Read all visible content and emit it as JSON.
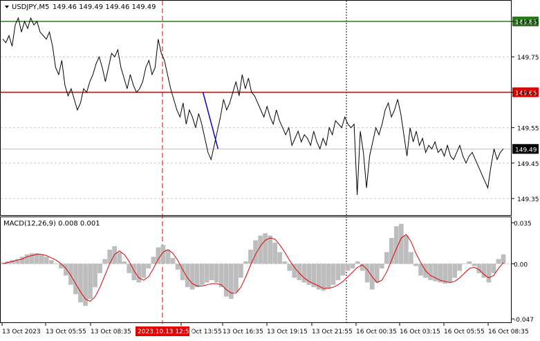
{
  "header": {
    "symbol_title": "USDJPY,M5",
    "ohlc": "149.46 149.49 149.46 149.49"
  },
  "macd_label": "MACD(12,26,9) 0.008 0.001",
  "colors": {
    "price_line": "#000000",
    "support_line": "#e00000",
    "resistance_line": "#2a7a1a",
    "trend_line": "#0000cc",
    "macd_hist": "#bdbdbd",
    "macd_signal": "#e00000",
    "grid": "#c8c8c8",
    "axis": "#000000"
  },
  "chart_data": [
    {
      "type": "line",
      "title": "USDJPY,M5",
      "ylim": [
        149.3,
        149.87
      ],
      "yticks": [
        "149.85",
        "149.75",
        "149.65",
        "149.55",
        "149.45",
        "149.35"
      ],
      "levels": [
        {
          "value": 149.85,
          "label": "149.85",
          "color": "#2a7a1a"
        },
        {
          "value": 149.65,
          "label": "149.65",
          "color": "#e00000"
        },
        {
          "value": 149.49,
          "label": "149.49",
          "color": "#000000",
          "role": "current"
        }
      ],
      "trendline": [
        {
          "bar": 0.4,
          "value": 149.65
        },
        {
          "bar": 0.43,
          "value": 149.49
        }
      ],
      "series": [
        {
          "values": [
            149.8,
            149.79,
            149.81,
            149.78,
            149.84,
            149.86,
            149.82,
            149.85,
            149.83,
            149.86,
            149.84,
            149.85,
            149.82,
            149.81,
            149.8,
            149.82,
            149.78,
            149.72,
            149.7,
            149.74,
            149.67,
            149.64,
            149.66,
            149.63,
            149.6,
            149.62,
            149.66,
            149.65,
            149.68,
            149.7,
            149.73,
            149.75,
            149.72,
            149.68,
            149.72,
            149.76,
            149.75,
            149.77,
            149.72,
            149.69,
            149.66,
            149.7,
            149.67,
            149.65,
            149.66,
            149.68,
            149.72,
            149.74,
            149.7,
            149.72,
            149.8,
            149.76,
            149.74,
            149.7,
            149.66,
            149.63,
            149.6,
            149.58,
            149.62,
            149.56,
            149.6,
            149.58,
            149.55,
            149.59,
            149.56,
            149.52,
            149.48,
            149.46,
            149.5,
            149.54,
            149.58,
            149.63,
            149.6,
            149.62,
            149.65,
            149.68,
            149.64,
            149.7,
            149.66,
            149.69,
            149.65,
            149.64,
            149.62,
            149.6,
            149.58,
            149.61,
            149.58,
            149.56,
            149.6,
            149.57,
            149.55,
            149.53,
            149.55,
            149.5,
            149.52,
            149.54,
            149.51,
            149.53,
            149.52,
            149.5,
            149.54,
            149.51,
            149.49,
            149.52,
            149.5,
            149.55,
            149.53,
            149.57,
            149.56,
            149.55,
            149.58,
            149.56,
            149.55,
            149.56,
            149.36,
            149.54,
            149.48,
            149.38,
            149.47,
            149.51,
            149.55,
            149.53,
            149.56,
            149.6,
            149.62,
            149.58,
            149.6,
            149.63,
            149.59,
            149.53,
            149.47,
            149.55,
            149.51,
            149.54,
            149.5,
            149.52,
            149.48,
            149.5,
            149.49,
            149.51,
            149.48,
            149.49,
            149.47,
            149.5,
            149.47,
            149.46,
            149.48,
            149.5,
            149.47,
            149.45,
            149.47,
            149.48,
            149.46,
            149.44,
            149.42,
            149.4,
            149.38,
            149.44,
            149.49,
            149.46,
            149.48,
            149.49
          ]
        }
      ]
    },
    {
      "type": "bar",
      "title": "MACD(12,26,9)",
      "ylim": [
        -0.047,
        0.035
      ],
      "yticks": [
        "0.035",
        "0.00",
        "-0.047"
      ],
      "series": [
        {
          "name": "MACD",
          "values": [
            0.001,
            0.002,
            0.003,
            0.004,
            0.006,
            0.008,
            0.009,
            0.009,
            0.008,
            0.006,
            0.003,
            0.0,
            -0.004,
            -0.01,
            -0.018,
            -0.026,
            -0.033,
            -0.036,
            -0.03,
            -0.02,
            -0.008,
            0.004,
            0.012,
            0.015,
            0.01,
            0.002,
            -0.008,
            -0.014,
            -0.016,
            -0.012,
            -0.004,
            0.006,
            0.014,
            0.016,
            0.012,
            0.005,
            -0.005,
            -0.014,
            -0.02,
            -0.022,
            -0.02,
            -0.018,
            -0.016,
            -0.014,
            -0.016,
            -0.02,
            -0.028,
            -0.03,
            -0.024,
            -0.012,
            0.002,
            0.012,
            0.02,
            0.024,
            0.026,
            0.024,
            0.018,
            0.01,
            0.002,
            -0.006,
            -0.012,
            -0.014,
            -0.016,
            -0.018,
            -0.02,
            -0.022,
            -0.023,
            -0.021,
            -0.018,
            -0.014,
            -0.01,
            -0.006,
            -0.004,
            0.002,
            -0.006,
            -0.016,
            -0.022,
            -0.016,
            -0.004,
            0.01,
            0.022,
            0.032,
            0.034,
            0.024,
            0.01,
            -0.002,
            -0.01,
            -0.012,
            -0.014,
            -0.015,
            -0.016,
            -0.017,
            -0.016,
            -0.012,
            -0.006,
            0.0,
            0.002,
            -0.002,
            -0.008,
            -0.012,
            -0.016,
            -0.008,
            0.004,
            0.008
          ]
        },
        {
          "name": "Signal",
          "values": [
            0.0,
            0.001,
            0.002,
            0.003,
            0.004,
            0.006,
            0.007,
            0.008,
            0.008,
            0.007,
            0.005,
            0.003,
            0.0,
            -0.004,
            -0.01,
            -0.017,
            -0.024,
            -0.03,
            -0.032,
            -0.028,
            -0.02,
            -0.01,
            0.0,
            0.008,
            0.011,
            0.008,
            0.002,
            -0.006,
            -0.012,
            -0.014,
            -0.011,
            -0.004,
            0.004,
            0.01,
            0.012,
            0.009,
            0.003,
            -0.005,
            -0.012,
            -0.017,
            -0.019,
            -0.019,
            -0.018,
            -0.017,
            -0.017,
            -0.018,
            -0.022,
            -0.025,
            -0.025,
            -0.02,
            -0.011,
            -0.001,
            0.008,
            0.015,
            0.02,
            0.022,
            0.021,
            0.016,
            0.01,
            0.003,
            -0.003,
            -0.008,
            -0.012,
            -0.015,
            -0.017,
            -0.019,
            -0.021,
            -0.021,
            -0.02,
            -0.018,
            -0.015,
            -0.011,
            -0.007,
            -0.003,
            -0.001,
            -0.005,
            -0.011,
            -0.016,
            -0.014,
            -0.007,
            0.003,
            0.013,
            0.022,
            0.025,
            0.019,
            0.009,
            0.001,
            -0.006,
            -0.01,
            -0.012,
            -0.014,
            -0.015,
            -0.016,
            -0.015,
            -0.012,
            -0.008,
            -0.004,
            -0.003,
            -0.005,
            -0.009,
            -0.012,
            -0.01,
            -0.004,
            0.001
          ]
        }
      ]
    }
  ],
  "xaxis": {
    "labels": [
      "13 Oct 2023",
      "13 Oct 05:55",
      "13 Oct 08:35",
      "13 Oct 13:55",
      "13 Oct 16:35",
      "13 Oct 19:15",
      "13 Oct 21:55",
      "16 Oct 00:35",
      "16 Oct 03:15",
      "16 Oct 05:55",
      "16 Oct 08:35"
    ],
    "highlight_label": "2023.10.13 12:55",
    "highlight_color": "#e00000"
  }
}
